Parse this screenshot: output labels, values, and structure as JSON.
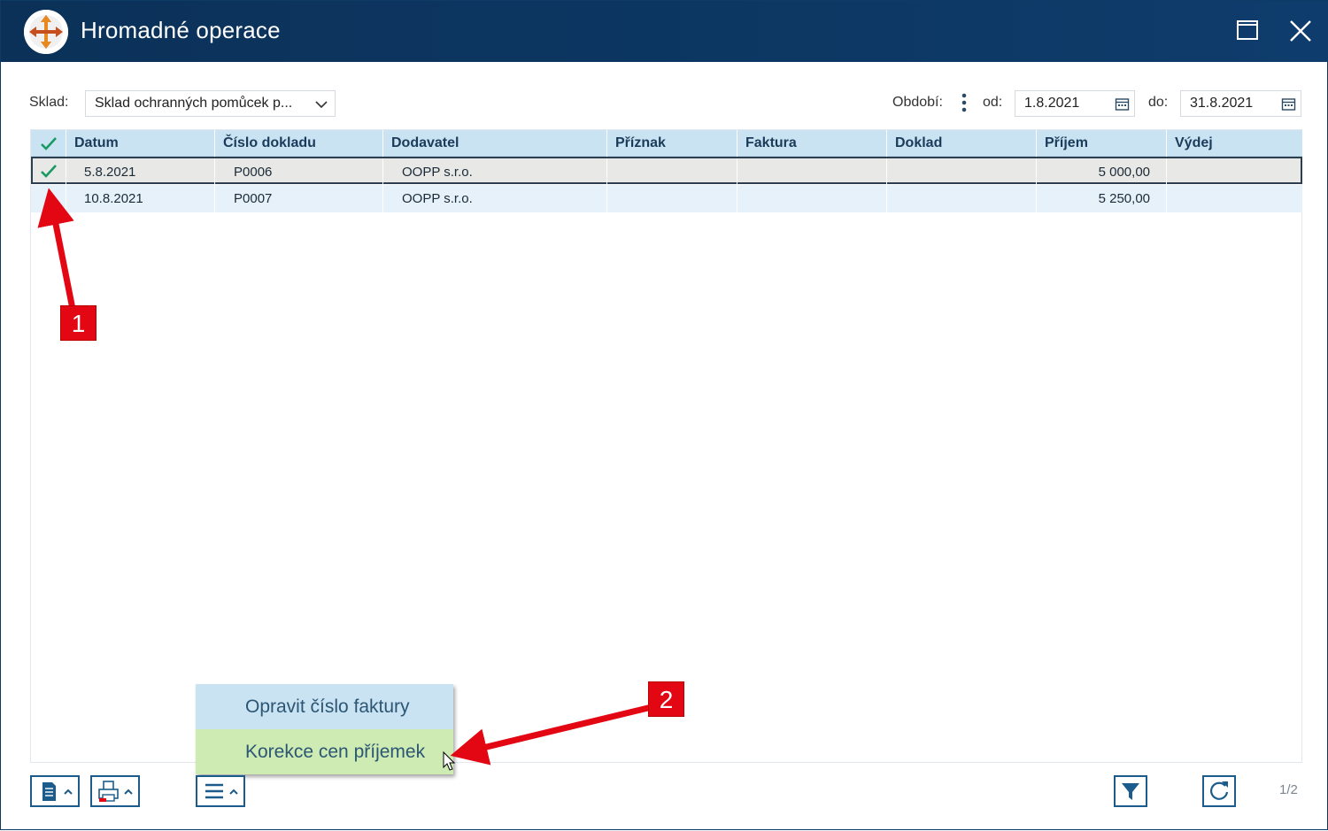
{
  "window": {
    "title": "Hromadné operace"
  },
  "filter": {
    "sklad_label": "Sklad:",
    "sklad_value": "Sklad ochranných pomůcek p...",
    "obdobi_label": "Období:",
    "od_label": "od:",
    "od_value": "1.8.2021",
    "do_label": "do:",
    "do_value": "31.8.2021"
  },
  "table": {
    "columns": [
      "Datum",
      "Číslo dokladu",
      "Dodavatel",
      "Příznak",
      "Faktura",
      "Doklad",
      "Příjem",
      "Výdej"
    ],
    "rows": [
      {
        "checked": true,
        "datum": "5.8.2021",
        "cislo": "P0006",
        "dodavatel": "OOPP s.r.o.",
        "priznak": "",
        "faktura": "",
        "doklad": "",
        "prijem": "5 000,00",
        "vydej": ""
      },
      {
        "checked": false,
        "datum": "10.8.2021",
        "cislo": "P0007",
        "dodavatel": "OOPP s.r.o.",
        "priznak": "",
        "faktura": "",
        "doklad": "",
        "prijem": "5 250,00",
        "vydej": ""
      }
    ]
  },
  "menu": {
    "items": [
      "Opravit číslo faktury",
      "Korekce cen příjemek"
    ]
  },
  "footer": {
    "pager": "1/2"
  },
  "annotations": {
    "one": "1",
    "two": "2"
  },
  "colors": {
    "titlebar": "#0e3c6c",
    "header": "#c9e3f3",
    "check": "#1a9a62",
    "annotation": "#e30613",
    "menu_hover": "#cdebb3"
  },
  "icons": [
    "app-logo-icon",
    "maximize-icon",
    "close-icon",
    "chevron-down-icon",
    "vertical-dots-icon",
    "calendar-icon",
    "check-icon",
    "document-icon",
    "printer-icon",
    "hamburger-menu-icon",
    "filter-icon",
    "refresh-icon",
    "mouse-cursor-icon"
  ]
}
